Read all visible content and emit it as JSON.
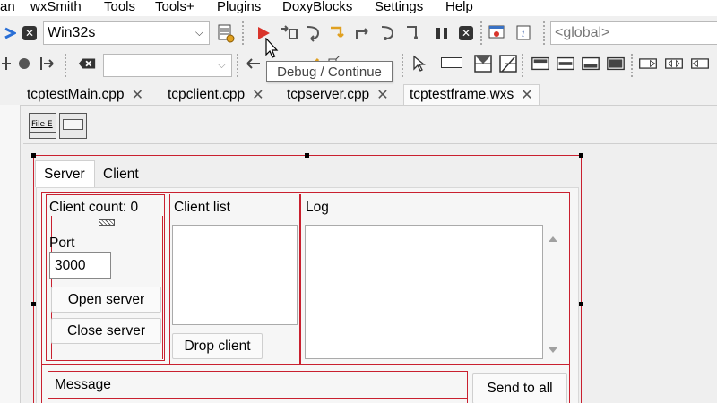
{
  "menu": [
    "an",
    "wxSmith",
    "Tools",
    "Tools+",
    "Plugins",
    "DoxyBlocks",
    "Settings",
    "Help"
  ],
  "toolbar": {
    "target_combo": "Win32s",
    "scope_combo": "<global>",
    "tooltip": "Debug / Continue"
  },
  "editor_tabs": [
    {
      "label": "tcptestMain.cpp",
      "close": "✕"
    },
    {
      "label": "tcpclient.cpp",
      "close": "✕"
    },
    {
      "label": "tcpserver.cpp",
      "close": "✕"
    },
    {
      "label": "tcptestframe.wxs",
      "close": "✕"
    }
  ],
  "palette": {
    "file_icon_text": "File E"
  },
  "designer": {
    "notebook_tabs": [
      "Server",
      "Client"
    ],
    "client_count_label": "Client count: 0",
    "port_label": "Port",
    "port_value": "3000",
    "open_server": "Open server",
    "close_server": "Close server",
    "client_list_label": "Client list",
    "drop_client": "Drop client",
    "log_label": "Log",
    "message_label": "Message",
    "send_to_all": "Send to all"
  },
  "colors": {
    "run_red": "#d9342b",
    "selection_red": "#c9202f"
  }
}
